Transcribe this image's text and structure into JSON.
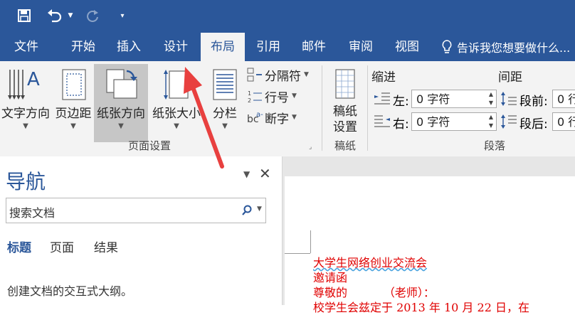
{
  "ribbon_tabs": [
    {
      "label": "文件"
    },
    {
      "label": "开始"
    },
    {
      "label": "插入"
    },
    {
      "label": "设计"
    },
    {
      "label": "布局",
      "active": true
    },
    {
      "label": "引用"
    },
    {
      "label": "邮件"
    },
    {
      "label": "审阅"
    },
    {
      "label": "视图"
    }
  ],
  "tell_me": "告诉我您想要做什么...",
  "page_setup": {
    "text_direction": "文字方向",
    "margins": "页边距",
    "orientation": "纸张方向",
    "size": "纸张大小",
    "columns": "分栏",
    "breaks": "分隔符",
    "line_numbers": "行号",
    "hyphenation": "断字",
    "group_label": "页面设置"
  },
  "draft": {
    "settings": "稿纸\n设置",
    "group_label": "稿纸"
  },
  "paragraph": {
    "indent_heading": "缩进",
    "spacing_heading": "间距",
    "left_label": "左:",
    "right_label": "右:",
    "left_value": "0 字符",
    "right_value": "0 字符",
    "before_label": "段前:",
    "after_label": "段后:",
    "before_value": "0 行",
    "after_value": "0 行",
    "group_label": "段落"
  },
  "nav": {
    "title": "导航",
    "search_placeholder": "搜索文档",
    "tabs": [
      "标题",
      "页面",
      "结果"
    ],
    "hint": "创建文档的交互式大纲。"
  },
  "document": {
    "lines": [
      "大学生网络创业交流会",
      "邀请函",
      "尊敬的          （老师）：",
      "校学生会兹定于 2013 年 10 月 22 日，在"
    ]
  },
  "colors": {
    "brand": "#2b579a",
    "doc_text": "#e00000",
    "arrow": "#e8403f"
  }
}
